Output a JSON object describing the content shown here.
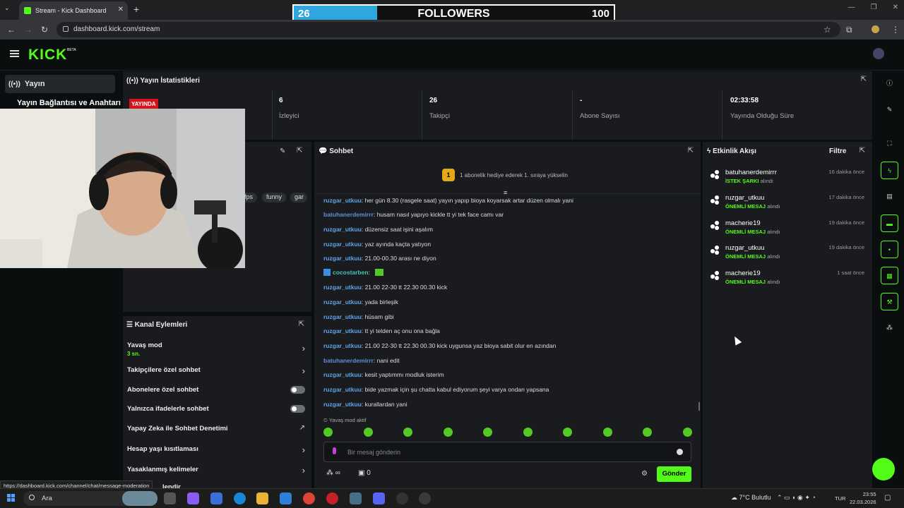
{
  "browser": {
    "tab_title": "Stream - Kick Dashboard",
    "url": "dashboard.kick.com/stream",
    "status_url": "https://dashboard.kick.com/channel/chat/message-moderation"
  },
  "overlay": {
    "followers_current": "26",
    "followers_label": "FOLLOWERS",
    "followers_goal": "100",
    "followers_progress": 0.26,
    "progress_color": "#2fa6de"
  },
  "header": {
    "logo": "KICK",
    "beta": "BETA",
    "brand_color": "#53fc18"
  },
  "sidebar": {
    "items": [
      {
        "label": "Yayın",
        "icon": "broadcast-icon"
      },
      {
        "label": "Yayın Bağlantısı ve Anahtarı"
      }
    ]
  },
  "stats": {
    "title": "Yayın İstatistikleri",
    "live_badge": "YAYINDA",
    "viewers_value": "6",
    "viewers_label": "İzleyici",
    "followers_value": "26",
    "followers_label": "Takipçi",
    "subs_value": "-",
    "subs_label": "Abone Sayısı",
    "uptime_value": "02:33:58",
    "uptime_label": "Yayında Olduğu Süre"
  },
  "stream_info": {
    "tags": [
      "fps",
      "funny",
      "gar"
    ]
  },
  "channel_actions": {
    "title": "Kanal Eylemleri",
    "slow_mode": "Yavaş mod",
    "slow_mode_value": "3 sn.",
    "followers_only": "Takipçilere özel sohbet",
    "subs_only": "Abonelere özel sohbet",
    "emotes_only": "Yalnızca ifadelerle sohbet",
    "ai_moderation": "Yapay Zeka ile Sohbet Denetimi",
    "age_restriction": "Hesap yaşı kısıtlaması",
    "banned_words": "Yasaklanmış kelimeler",
    "cut_off": "lendir"
  },
  "chat": {
    "title": "Sohbet",
    "pinned_rank": "1",
    "pinned_text": "1 abonelik hediye ederek 1. sıraya yükselin",
    "messages": [
      {
        "user": "ruzgar_utkuu",
        "text": "her gün 8.30 (rasgele saat) yayın yapıp bioya koyarsak artar düzen olmalı yani"
      },
      {
        "user": "batuhanerdemirrr",
        "text": "husam nasıl yapıyo kickle tt yi tek face camı var"
      },
      {
        "user": "ruzgar_utkuu",
        "text": "düzensiz saat işini aşalım"
      },
      {
        "user": "ruzgar_utkuu",
        "text": "yaz ayında kaçta yatıyon"
      },
      {
        "user": "ruzgar_utkuu",
        "text": "21.00-00.30 arası ne diyon"
      },
      {
        "user": "cocostarben",
        "text": ""
      },
      {
        "user": "ruzgar_utkuu",
        "text": "21.00 22-30 tt 22.30 00.30 kick"
      },
      {
        "user": "ruzgar_utkuu",
        "text": "yada birleşik"
      },
      {
        "user": "ruzgar_utkuu",
        "text": "hüsam gibi"
      },
      {
        "user": "ruzgar_utkuu",
        "text": "tt yi telden aç onu ona bağla"
      },
      {
        "user": "ruzgar_utkuu",
        "text": "21.00 22-30 tt 22.30 00.30 kick uygunsa yaz bioya sabit olur en azından"
      },
      {
        "user": "batuhanerdemirrr",
        "text": "nani edit"
      },
      {
        "user": "ruzgar_utkuu",
        "text": "kesit yaptımmı modluk isterim"
      },
      {
        "user": "ruzgar_utkuu",
        "text": "bide yazmak için şu chatta kabul ediyorum şeyi varya ondan yapsana"
      },
      {
        "user": "ruzgar_utkuu",
        "text": "kurallardan yani"
      }
    ],
    "slow_mode_active": "Yavaş mod aktif",
    "input_placeholder": "Bir mesaj gönderin",
    "points": "∞",
    "bag_count": "0",
    "send_label": "Gönder"
  },
  "events": {
    "title": "Etkinlik Akışı",
    "filter_label": "Filtre",
    "received": "alındı",
    "items": [
      {
        "user": "batuhanerdemirrr",
        "type": "İSTEK ŞARKI",
        "time": "16 dakika önce"
      },
      {
        "user": "ruzgar_utkuu",
        "type": "ÖNEMLİ MESAJ",
        "time": "17 dakika önce"
      },
      {
        "user": "macherie19",
        "type": "ÖNEMLİ MESAJ",
        "time": "19 dakika önce"
      },
      {
        "user": "ruzgar_utkuu",
        "type": "ÖNEMLİ MESAJ",
        "time": "19 dakika önce"
      },
      {
        "user": "macherie19",
        "type": "ÖNEMLİ MESAJ",
        "time": "1 saat önce"
      }
    ]
  },
  "taskbar": {
    "search": "Ara",
    "temperature": "7°C",
    "weather": "Bulutlu",
    "language": "TUR",
    "time": "23:55",
    "date": "22.03.2026"
  }
}
